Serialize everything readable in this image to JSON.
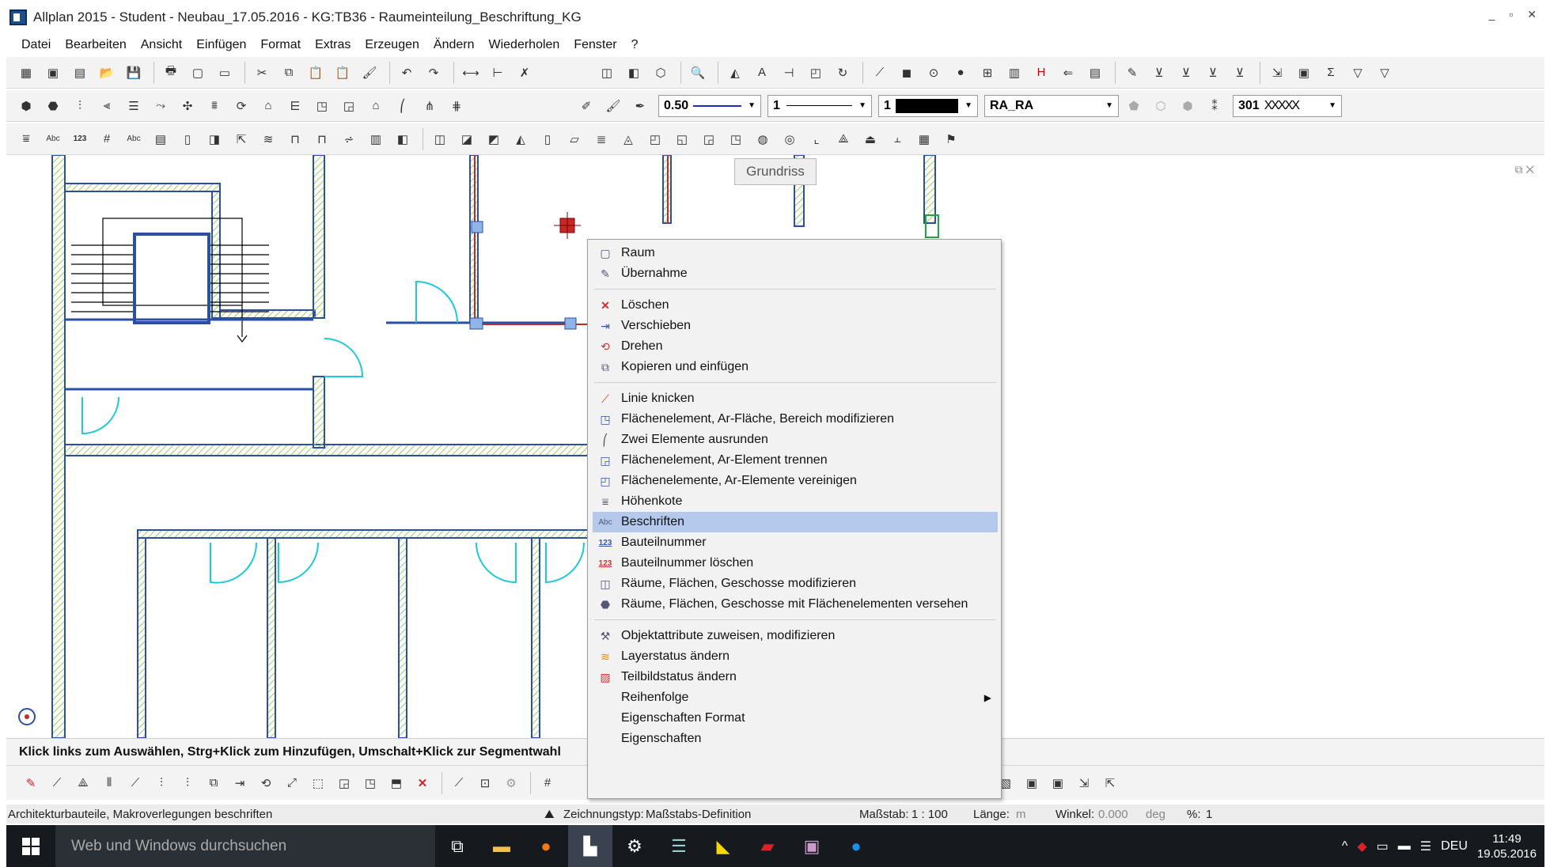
{
  "window": {
    "title": "Allplan 2015 - Student - Neubau_17.05.2016 - KG:TB36 - Raumeinteilung_Beschriftung_KG",
    "controls": [
      "_",
      "▫",
      "✕"
    ]
  },
  "menu": [
    "Datei",
    "Bearbeiten",
    "Ansicht",
    "Einfügen",
    "Format",
    "Extras",
    "Erzeugen",
    "Ändern",
    "Wiederholen",
    "Fenster",
    "?"
  ],
  "properties": {
    "pen": "0.50",
    "line": "1",
    "color": "1",
    "layer": "RA_RA",
    "hatch": "301"
  },
  "canvas": {
    "tooltip": "Grundriss"
  },
  "context_menu": {
    "items": [
      {
        "label": "Raum",
        "icon": "room-icon"
      },
      {
        "label": "Übernahme",
        "icon": "pipette-icon"
      },
      {
        "label": "Löschen",
        "icon": "delete-icon"
      },
      {
        "label": "Verschieben",
        "icon": "move-icon"
      },
      {
        "label": "Drehen",
        "icon": "rotate-icon"
      },
      {
        "label": "Kopieren und einfügen",
        "icon": "copy-icon"
      },
      {
        "label": "Linie knicken",
        "icon": "line-bend-icon"
      },
      {
        "label": "Flächenelement, Ar-Fläche, Bereich modifizieren",
        "icon": "area-modify-icon"
      },
      {
        "label": "Zwei Elemente ausrunden",
        "icon": "fillet-icon"
      },
      {
        "label": "Flächenelement, Ar-Element trennen",
        "icon": "area-split-icon"
      },
      {
        "label": "Flächenelemente, Ar-Elemente vereinigen",
        "icon": "area-merge-icon"
      },
      {
        "label": "Höhenkote",
        "icon": "elevation-icon"
      },
      {
        "label": "Beschriften",
        "icon": "label-abc-icon",
        "highlighted": true
      },
      {
        "label": "Bauteilnummer",
        "icon": "component-number-icon"
      },
      {
        "label": "Bauteilnummer löschen",
        "icon": "component-number-delete-icon"
      },
      {
        "label": "Räume, Flächen, Geschosse modifizieren",
        "icon": "rooms-modify-icon"
      },
      {
        "label": "Räume, Flächen, Geschosse mit Flächenelementen versehen",
        "icon": "rooms-area-icon"
      },
      {
        "label": "Objektattribute zuweisen, modifizieren",
        "icon": "attributes-icon"
      },
      {
        "label": "Layerstatus ändern",
        "icon": "layer-icon"
      },
      {
        "label": "Teilbildstatus ändern",
        "icon": "drawing-file-icon"
      },
      {
        "label": "Reihenfolge",
        "icon": "",
        "submenu": true
      },
      {
        "label": "Eigenschaften Format",
        "icon": ""
      },
      {
        "label": "Eigenschaften",
        "icon": ""
      }
    ]
  },
  "hint": "Klick links zum Auswählen, Strg+Klick zum Hinzufügen, Umschalt+Klick zur Segmentwahl",
  "status": {
    "left": "Architekturbauteile, Makroverlegungen beschriften",
    "drawing_type_label": "Zeichnungstyp:",
    "drawing_type_value": "Maßstabs-Definition",
    "scale_label": "Maßstab:",
    "scale_value": "1 : 100",
    "length_label": "Länge:",
    "length_unit": "m",
    "angle_label": "Winkel:",
    "angle_value": "0.000",
    "angle_unit": "deg",
    "percent_label": "%:",
    "percent_value": "1"
  },
  "taskbar": {
    "search_placeholder": "Web und Windows durchsuchen",
    "language": "DEU",
    "time": "11:49",
    "date": "19.05.2016"
  },
  "colors": {
    "wall_blue": "#2d4fa3",
    "hatch_green": "#9bd15a",
    "door_cyan": "#1ec9d8",
    "highlight": "#b4c9ec"
  }
}
